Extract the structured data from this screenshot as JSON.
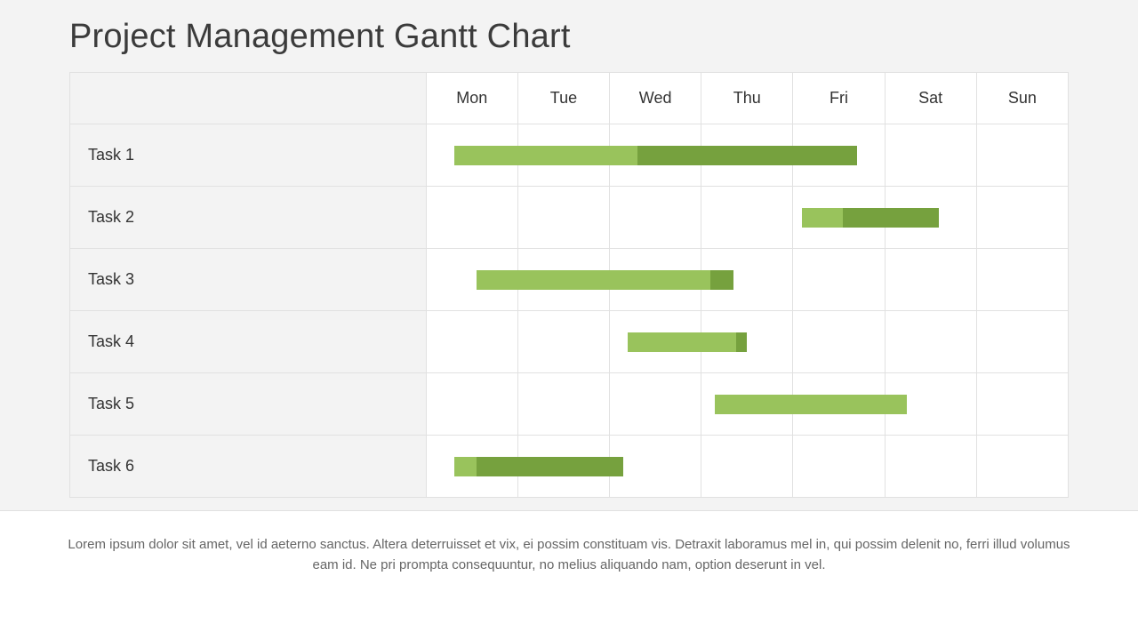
{
  "title": "Project Management Gantt Chart",
  "footer_text": "Lorem ipsum dolor sit amet, vel id aeterno sanctus. Altera deterruisset et vix, ei possim constituam vis. Detraxit laboramus mel in, qui possim delenit no, ferri illud volumus eam id. Ne pri prompta consequuntur, no melius aliquando nam, option deserunt in vel.",
  "colors": {
    "light": "#99c35c",
    "dark": "#76a13e",
    "page_bg": "#f3f3f3"
  },
  "chart_data": {
    "type": "bar",
    "subtype": "gantt",
    "categories": [
      "Mon",
      "Tue",
      "Wed",
      "Thu",
      "Fri",
      "Sat",
      "Sun"
    ],
    "day_index": {
      "Mon": 0,
      "Tue": 1,
      "Wed": 2,
      "Thu": 3,
      "Fri": 4,
      "Sat": 5,
      "Sun": 6
    },
    "tasks": [
      {
        "name": "Task 1",
        "start": 0.3,
        "segments": [
          {
            "len": 2.0,
            "color": "light"
          },
          {
            "len": 2.4,
            "color": "dark"
          }
        ]
      },
      {
        "name": "Task 2",
        "start": 4.1,
        "segments": [
          {
            "len": 0.45,
            "color": "light"
          },
          {
            "len": 1.05,
            "color": "dark"
          }
        ]
      },
      {
        "name": "Task 3",
        "start": 0.55,
        "segments": [
          {
            "len": 2.55,
            "color": "light"
          },
          {
            "len": 0.25,
            "color": "dark"
          }
        ]
      },
      {
        "name": "Task 4",
        "start": 2.2,
        "segments": [
          {
            "len": 1.18,
            "color": "light"
          },
          {
            "len": 0.12,
            "color": "dark"
          }
        ]
      },
      {
        "name": "Task 5",
        "start": 3.15,
        "segments": [
          {
            "len": 2.1,
            "color": "light"
          }
        ]
      },
      {
        "name": "Task 6",
        "start": 0.3,
        "segments": [
          {
            "len": 0.25,
            "color": "light"
          },
          {
            "len": 1.6,
            "color": "dark"
          }
        ]
      }
    ],
    "title": "Project Management Gantt Chart",
    "xlabel": "",
    "ylabel": ""
  }
}
